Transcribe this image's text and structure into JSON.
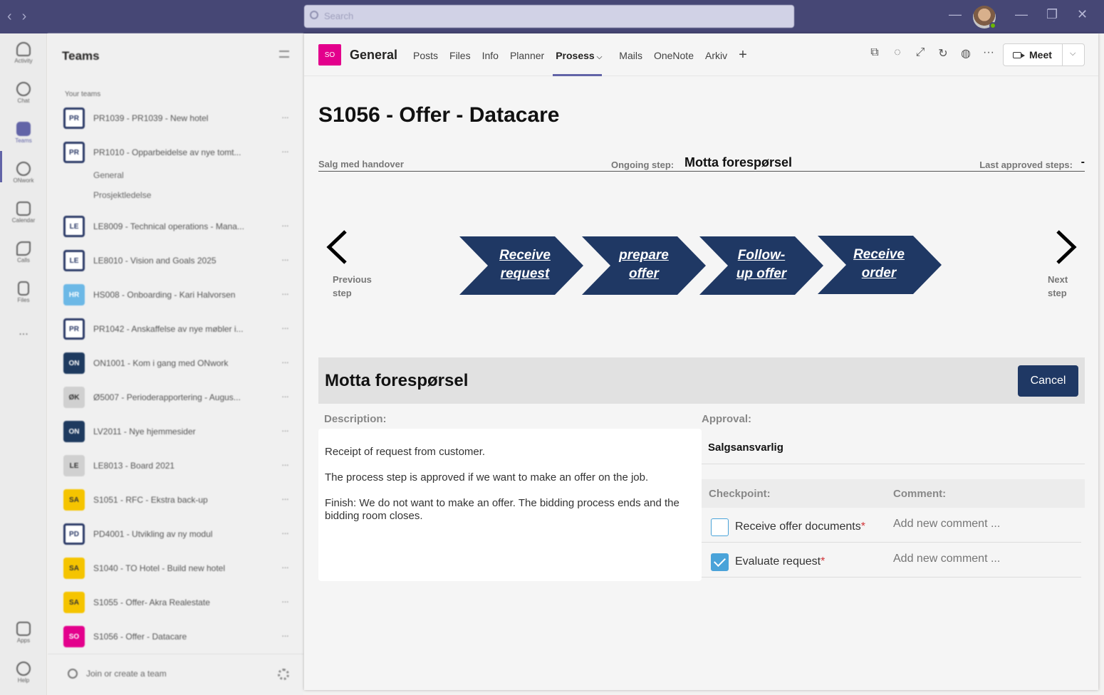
{
  "app": {
    "search_placeholder": "Search"
  },
  "rail": {
    "items": [
      {
        "label": "Activity"
      },
      {
        "label": "Chat"
      },
      {
        "label": "Teams"
      },
      {
        "label": "ONwork"
      },
      {
        "label": "Calendar"
      },
      {
        "label": "Calls"
      },
      {
        "label": "Files"
      },
      {
        "label": "..."
      },
      {
        "label": "Apps"
      },
      {
        "label": "Help"
      }
    ]
  },
  "sidebar": {
    "title": "Teams",
    "section_label": "Your teams",
    "teams": [
      {
        "badge": "PR",
        "name": "PR1039 - PR1039 - New hotel",
        "badge_color": "#2b3a67"
      },
      {
        "badge": "PR",
        "name": "PR1010 - Opparbeidelse av nye tomt...",
        "badge_color": "#2b3a67"
      },
      {
        "badge": "LE",
        "name": "LE8009 - Technical operations - Mana...",
        "badge_color": "#2b3a67"
      },
      {
        "badge": "LE",
        "name": "LE8010 - Vision and Goals 2025",
        "badge_color": "#2b3a67"
      },
      {
        "badge": "HR",
        "name": "HS008 - Onboarding - Kari Halvorsen",
        "badge_color": "#6cb8e6"
      },
      {
        "badge": "PR",
        "name": "PR1042 - Anskaffelse av nye møbler i...",
        "badge_color": "#2b3a67"
      },
      {
        "badge": "ON",
        "name": "ON1001 - Kom i gang med ONwork",
        "badge_color": "#1e3a5f"
      },
      {
        "badge": "ØK",
        "name": "Ø5007 - Perioderapportering - Augus...",
        "badge_color": "#d0d0d0"
      },
      {
        "badge": "ON",
        "name": "LV2011 - Nye hjemmesider",
        "badge_color": "#1e3a5f"
      },
      {
        "badge": "LE",
        "name": "LE8013 - Board 2021",
        "badge_color": "#d0d0d0"
      },
      {
        "badge": "SA",
        "name": "S1051 - RFC - Ekstra back-up",
        "badge_color": "#f5c400"
      },
      {
        "badge": "PD",
        "name": "PD4001 - Utvikling av ny modul",
        "badge_color": "#2b3a67"
      },
      {
        "badge": "SA",
        "name": "S1040 - TO Hotel - Build new hotel",
        "badge_color": "#f5c400"
      },
      {
        "badge": "SA",
        "name": "S1055 - Offer- Akra Realestate",
        "badge_color": "#f5c400"
      },
      {
        "badge": "SO",
        "name": "S1056 - Offer - Datacare",
        "badge_color": "#e3008c"
      }
    ],
    "channels": [
      "General",
      "Prosjektledelse"
    ],
    "join_label": "Join or create a team"
  },
  "header": {
    "badge": "SO",
    "channel_title": "General",
    "tabs": [
      "Posts",
      "Files",
      "Info",
      "Planner",
      "Prosess",
      "Mails",
      "OneNote",
      "Arkiv"
    ],
    "active_tab": "Prosess",
    "add_tab": "+",
    "meet_label": "Meet"
  },
  "process": {
    "title": "S1056 - Offer - Datacare",
    "process_name": "Salg med handover",
    "ongoing_label": "Ongoing step:",
    "ongoing_value": "Motta forespørsel",
    "last_label": "Last approved steps:",
    "last_value": "-",
    "prev_label": "Previous step",
    "next_label": "Next step",
    "steps": [
      {
        "line1": "Receive",
        "line2": "request"
      },
      {
        "line1": "prepare",
        "line2": "offer"
      },
      {
        "line1": "Follow-",
        "line2": "up offer"
      },
      {
        "line1": "Receive",
        "line2": "order"
      }
    ],
    "step_color": "#1f3864"
  },
  "panel": {
    "title": "Motta forespørsel",
    "cancel_label": "Cancel",
    "description_label": "Description:",
    "description": [
      "Receipt of request from customer.",
      "The process step is approved if we want to make an offer on the job.",
      "Finish: We do not want to make an offer. The bidding process ends and the bidding room closes."
    ],
    "approval_label": "Approval:",
    "approval_value": "Salgsansvarlig",
    "checkpoint_label": "Checkpoint:",
    "comment_label": "Comment:",
    "checkpoints": [
      {
        "label": "Receive offer documents",
        "required": "*",
        "checked": false,
        "comment_placeholder": "Add new comment ..."
      },
      {
        "label": "Evaluate request",
        "required": "*",
        "checked": true,
        "comment_placeholder": "Add new comment ..."
      }
    ]
  }
}
